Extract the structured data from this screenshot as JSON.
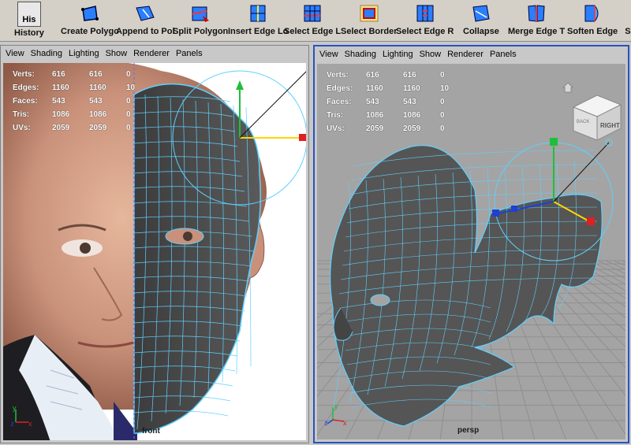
{
  "shelf": {
    "items": [
      {
        "label": "History",
        "icon": "history-icon",
        "icon_text": "His"
      },
      {
        "label": "Create Polygo",
        "icon": "create-polygon-icon"
      },
      {
        "label": "Append to Pol",
        "icon": "append-polygon-icon"
      },
      {
        "label": "Split Polygon",
        "icon": "split-polygon-icon"
      },
      {
        "label": "Insert Edge Lo",
        "icon": "insert-edge-loop-icon"
      },
      {
        "label": "Select Edge L",
        "icon": "select-edge-loop-icon"
      },
      {
        "label": "Select Border",
        "icon": "select-border-icon"
      },
      {
        "label": "Select Edge R",
        "icon": "select-edge-ring-icon"
      },
      {
        "label": "Collapse",
        "icon": "collapse-icon"
      },
      {
        "label": "Merge Edge T",
        "icon": "merge-edge-icon"
      },
      {
        "label": "Soften Edge",
        "icon": "soften-edge-icon"
      },
      {
        "label": "Sc",
        "icon": "script-icon"
      }
    ]
  },
  "panels": {
    "menu": [
      "View",
      "Shading",
      "Lighting",
      "Show",
      "Renderer",
      "Panels"
    ],
    "left": {
      "camera": "front",
      "hud": [
        {
          "key": "Verts:",
          "a": "616",
          "b": "616",
          "c": "0"
        },
        {
          "key": "Edges:",
          "a": "1160",
          "b": "1160",
          "c": "10"
        },
        {
          "key": "Faces:",
          "a": "543",
          "b": "543",
          "c": "0"
        },
        {
          "key": "Tris:",
          "a": "1086",
          "b": "1086",
          "c": "0"
        },
        {
          "key": "UVs:",
          "a": "2059",
          "b": "2059",
          "c": "0"
        }
      ],
      "axis": {
        "y": "y",
        "z": "z",
        "x": "x"
      }
    },
    "right": {
      "camera": "persp",
      "viewcube_label": "RIGHT",
      "viewcube_side": "BACK",
      "hud": [
        {
          "key": "Verts:",
          "a": "616",
          "b": "616",
          "c": "0"
        },
        {
          "key": "Edges:",
          "a": "1160",
          "b": "1160",
          "c": "10"
        },
        {
          "key": "Faces:",
          "a": "543",
          "b": "543",
          "c": "0"
        },
        {
          "key": "Tris:",
          "a": "1086",
          "b": "1086",
          "c": "0"
        },
        {
          "key": "UVs:",
          "a": "2059",
          "b": "2059",
          "c": "0"
        }
      ],
      "axis": {
        "y": "y",
        "z": "z",
        "x": "x"
      }
    }
  },
  "colors": {
    "active_border": "#2a52be",
    "wire": "#5fd0ff",
    "mesh": "#4a4a4a",
    "manip_y": "#1fbf3a",
    "manip_x": "#e02020",
    "manip_z": "#2040d0"
  }
}
